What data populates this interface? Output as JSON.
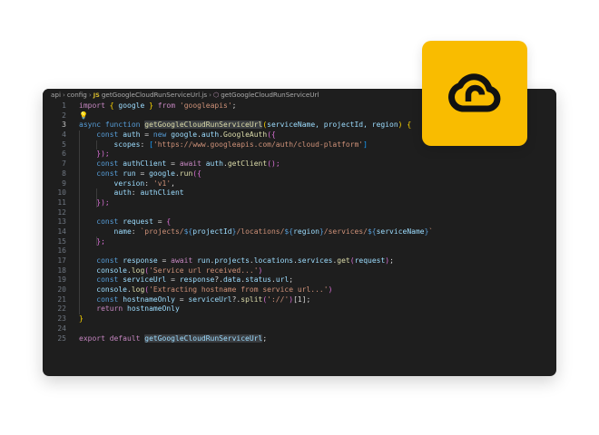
{
  "breadcrumb": {
    "seg1": "api",
    "seg2": "config",
    "file": "getGoogleCloudRunServiceUrl.js",
    "symbol": "getGoogleCloudRunServiceUrl",
    "js_label": "JS"
  },
  "badge": {
    "icon": "cloud-run-icon",
    "color": "#f9bc00"
  },
  "editor": {
    "theme_background": "#1e1e1e",
    "active_line": 3,
    "line_numbers": [
      "1",
      "2",
      "3",
      "4",
      "5",
      "6",
      "7",
      "8",
      "9",
      "10",
      "11",
      "12",
      "13",
      "14",
      "15",
      "16",
      "17",
      "18",
      "19",
      "20",
      "21",
      "22",
      "23",
      "24",
      "25"
    ],
    "code": {
      "l1": {
        "kw": "import",
        "ob": "{",
        "name": "google",
        "cb": "}",
        "from": "from",
        "module": "'googleapis'",
        "semi": ";"
      },
      "l3": {
        "async": "async",
        "function": "function",
        "fname": "getGoogleCloudRunServiceUrl",
        "lp": "(",
        "params": "serviceName, projectId, region",
        "rp": ")",
        "ob": "{"
      },
      "l4": {
        "const": "const",
        "name": "auth",
        "eq": " = ",
        "new": "new",
        "obj": "google",
        "dot1": ".",
        "prop": "auth",
        "dot2": ".",
        "cls": "GoogleAuth",
        "open": "({"
      },
      "l5": {
        "key": "scopes",
        "colon": ": ",
        "lb": "[",
        "value": "'https://www.googleapis.com/auth/cloud-platform'",
        "rb": "]"
      },
      "l6": {
        "close": "});"
      },
      "l7": {
        "const": "const",
        "name": "authClient",
        "eq": " = ",
        "await": "await",
        "obj": "auth",
        "dot": ".",
        "method": "getClient",
        "call": "();"
      },
      "l8": {
        "const": "const",
        "name": "run",
        "eq": " = ",
        "obj": "google",
        "dot": ".",
        "method": "run",
        "open": "({"
      },
      "l9": {
        "key": "version",
        "colon": ": ",
        "value": "'v1'",
        "comma": ","
      },
      "l10": {
        "key": "auth",
        "colon": ": ",
        "value": "authClient"
      },
      "l11": {
        "close": "});"
      },
      "l13": {
        "const": "const",
        "name": "request",
        "eq": " = ",
        "open": "{"
      },
      "l14": {
        "key": "name",
        "colon": ": ",
        "s1": "`projects/",
        "o1": "${",
        "v1": "projectId",
        "c1": "}",
        "s2": "/locations/",
        "o2": "${",
        "v2": "region",
        "c2": "}",
        "s3": "/services/",
        "o3": "${",
        "v3": "serviceName",
        "c3": "}",
        "s4": "`"
      },
      "l15": {
        "close": "};"
      },
      "l17": {
        "const": "const",
        "name": "response",
        "eq": " = ",
        "await": "await",
        "o1": "run",
        "o2": "projects",
        "o3": "locations",
        "o4": "services",
        "dot": ".",
        "method": "get",
        "lp": "(",
        "arg": "request",
        "rp": ")",
        "semi": ";"
      },
      "l18": {
        "obj": "console",
        "dot": ".",
        "method": "log",
        "lp": "(",
        "value": "'Service url received...'",
        "rp": ")"
      },
      "l19": {
        "const": "const",
        "name": "serviceUrl",
        "eq": " = ",
        "o1": "response",
        "q": "?.",
        "o2": "data",
        "o3": "status",
        "o4": "url",
        "dot": ".",
        "semi": ";"
      },
      "l20": {
        "obj": "console",
        "dot": ".",
        "method": "log",
        "lp": "(",
        "value": "'Extracting hostname from service url...'",
        "rp": ")"
      },
      "l21": {
        "const": "const",
        "name": "hostnameOnly",
        "eq": " = ",
        "obj": "serviceUrl",
        "q": "?.",
        "method": "split",
        "lp": "(",
        "value": "'://'",
        "rp": ")",
        "index": "[1]",
        "semi": ";"
      },
      "l22": {
        "ret": "return",
        "value": "hostnameOnly"
      },
      "l23": {
        "close": "}"
      },
      "l25": {
        "export": "export",
        "default": "default",
        "name": "getGoogleCloudRunServiceUrl",
        "semi": ";"
      }
    }
  }
}
